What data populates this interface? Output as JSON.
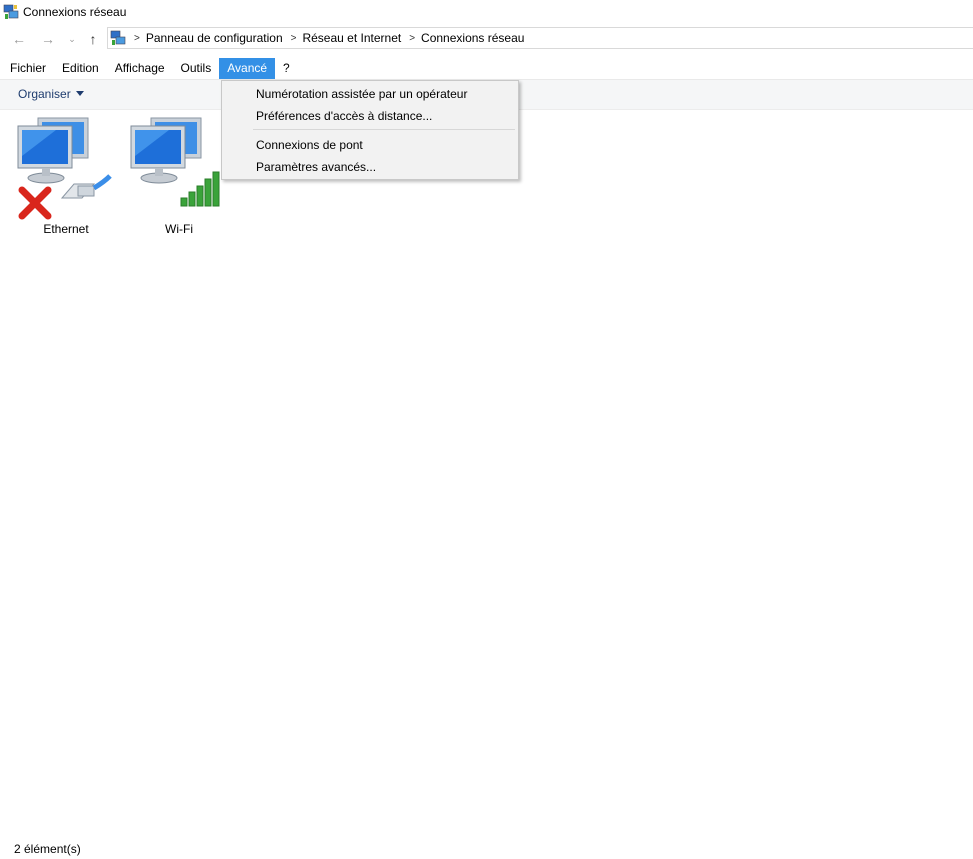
{
  "window": {
    "title": "Connexions réseau"
  },
  "address": {
    "crumbs": [
      "Panneau de configuration",
      "Réseau et Internet",
      "Connexions réseau"
    ]
  },
  "menubar": {
    "items": [
      "Fichier",
      "Edition",
      "Affichage",
      "Outils",
      "Avancé",
      "?"
    ],
    "active": "Avancé"
  },
  "toolbar": {
    "organise_label": "Organiser"
  },
  "dropdown": {
    "items": [
      "Numérotation assistée par un opérateur",
      "Préférences d'accès à distance...",
      "Connexions de pont",
      "Paramètres avancés..."
    ]
  },
  "connections": [
    {
      "name": "Ethernet",
      "status_icon": "disconnected-x-icon"
    },
    {
      "name": "Wi-Fi",
      "status_icon": "signal-bars-icon"
    }
  ],
  "statusbar": {
    "count": "2 élément(s)"
  },
  "colors": {
    "accent": "#3390e6",
    "link": "#1e3c6e",
    "error": "#d9261c",
    "signal": "#3aa33a"
  }
}
